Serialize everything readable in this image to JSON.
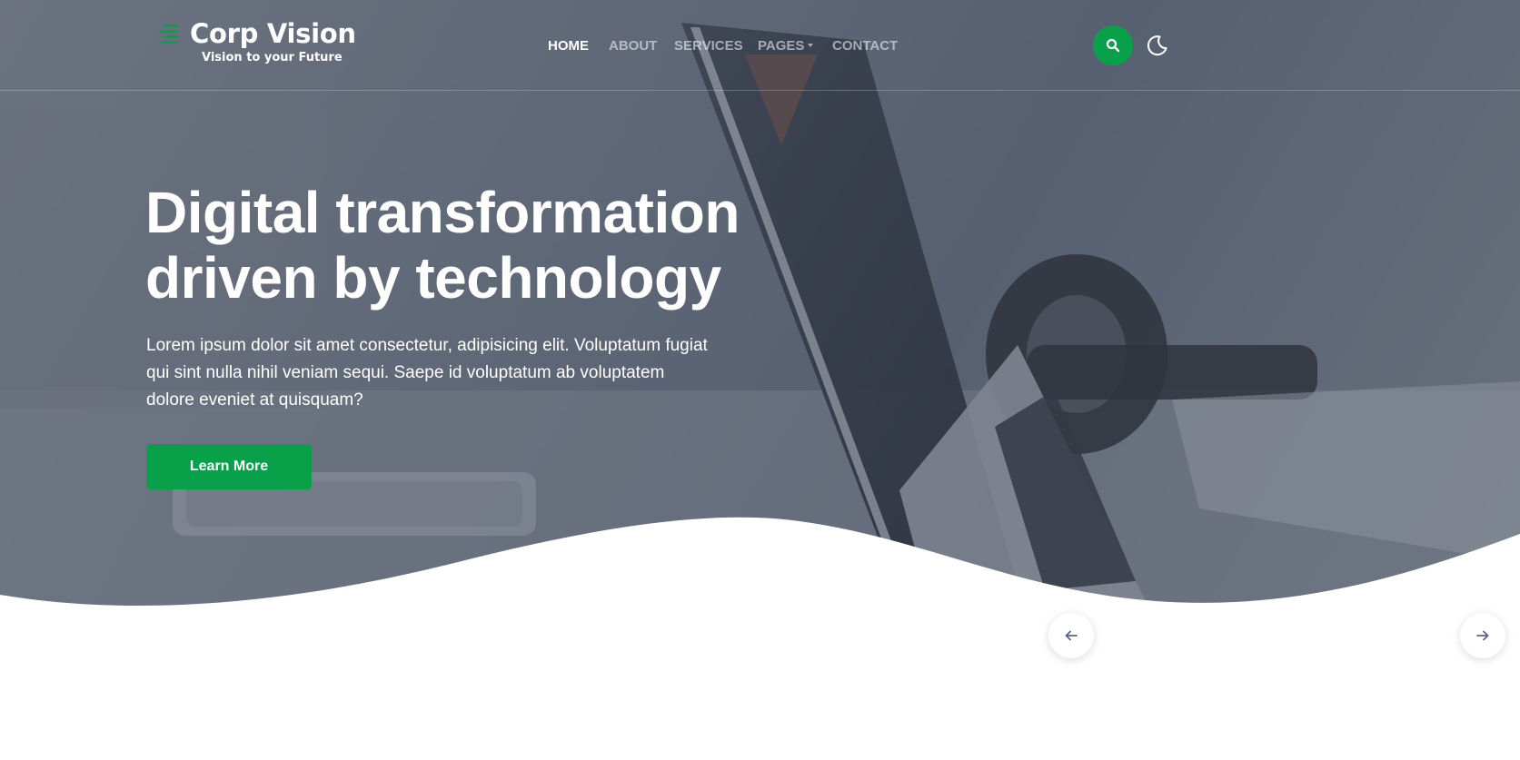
{
  "brand": {
    "name": "Corp Vision",
    "tagline": "Vision to your Future",
    "icon": "menu-lines-icon"
  },
  "nav": {
    "items": [
      {
        "label": "HOME",
        "active": true
      },
      {
        "label": "ABOUT",
        "active": false
      },
      {
        "label": "SERVICES",
        "active": false
      },
      {
        "label": "PAGES",
        "active": false,
        "dropdown": true
      },
      {
        "label": "CONTACT",
        "active": false
      }
    ],
    "search_icon": "search-icon",
    "theme_icon": "moon-icon"
  },
  "hero": {
    "title_line1": "Digital transformation",
    "title_line2": "driven by technology",
    "text": "Lorem ipsum dolor sit amet consectetur, adipisicing elit. Voluptatum fugiat qui sint nulla nihil veniam sequi. Saepe id voluptatum ab voluptatem dolore eveniet at quisquam?",
    "cta_label": "Learn More"
  },
  "slider": {
    "prev_icon": "arrow-left-icon",
    "next_icon": "arrow-right-icon"
  },
  "colors": {
    "accent": "#08a14a",
    "overlay": "#5f6877",
    "text_light": "#ffffff",
    "arrow": "#5a6490"
  }
}
